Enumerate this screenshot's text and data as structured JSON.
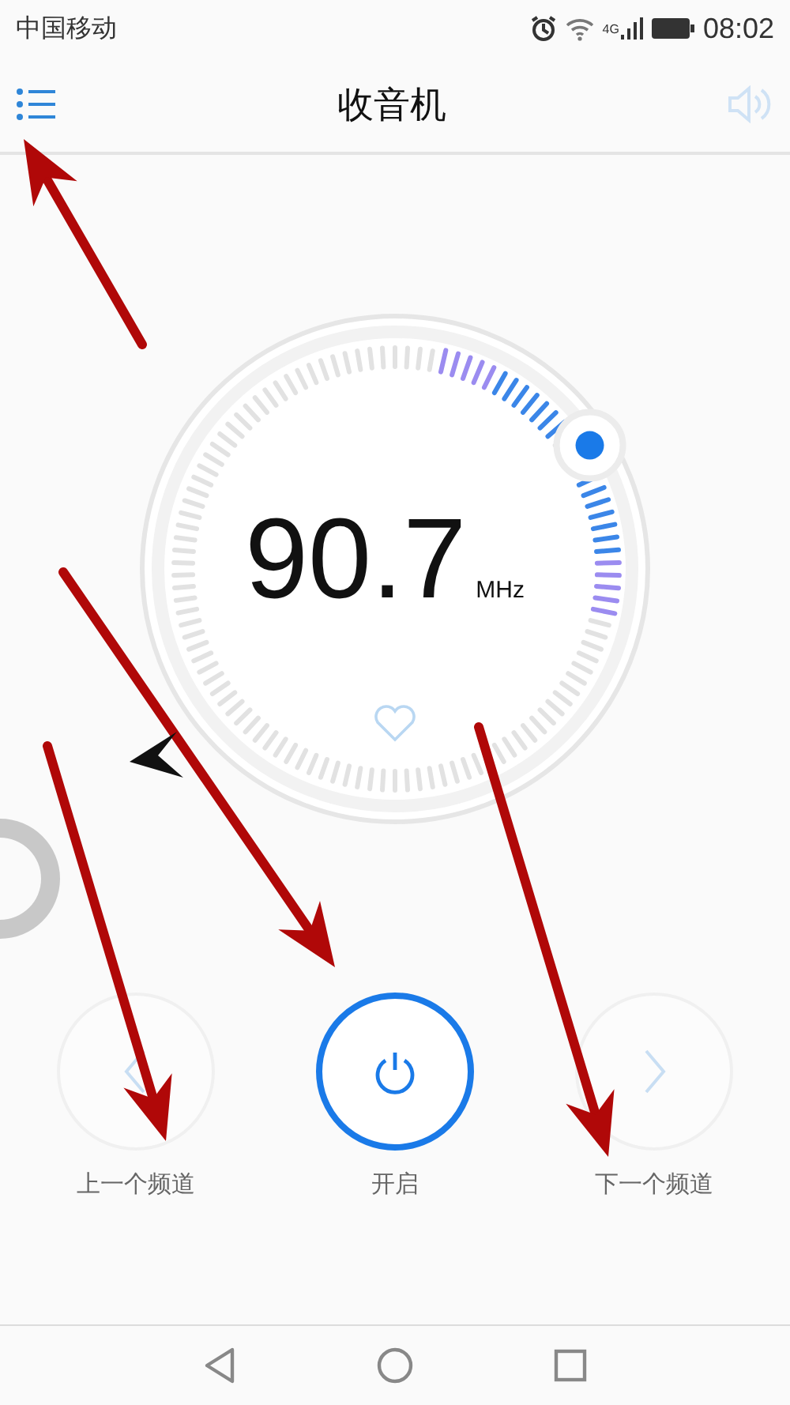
{
  "status_bar": {
    "carrier": "中国移动",
    "network": "4G",
    "time": "08:02"
  },
  "header": {
    "title": "收音机"
  },
  "dial": {
    "frequency": "90.7",
    "unit": "MHz",
    "favorite": false
  },
  "controls": [
    {
      "kind": "prev",
      "label": "上一个频道"
    },
    {
      "kind": "power",
      "label": "开启"
    },
    {
      "kind": "next",
      "label": "下一个频道"
    }
  ]
}
